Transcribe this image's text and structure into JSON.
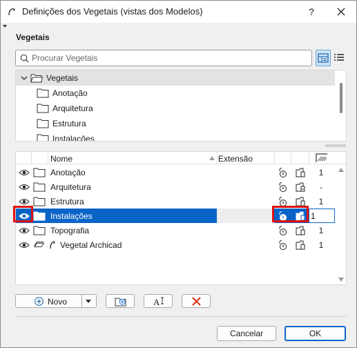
{
  "window": {
    "title": "Definições dos Vegetais (vistas dos Modelos)",
    "help_label": "?",
    "close_label": "✕"
  },
  "section": {
    "title": "Vegetais"
  },
  "search": {
    "placeholder": "Procurar Vegetais",
    "value": ""
  },
  "tree": {
    "root": {
      "label": "Vegetais",
      "expanded": true
    },
    "children": [
      {
        "label": "Anotação"
      },
      {
        "label": "Arquitetura"
      },
      {
        "label": "Estrutura"
      },
      {
        "label": "Instalações"
      }
    ]
  },
  "list": {
    "columns": {
      "name": "Nome",
      "extension": "Extensão"
    },
    "rows": [
      {
        "name": "Anotação",
        "type": "folder",
        "visible": true,
        "pen": "1",
        "selected": false
      },
      {
        "name": "Arquitetura",
        "type": "folder",
        "visible": true,
        "pen": "-",
        "selected": false
      },
      {
        "name": "Estrutura",
        "type": "folder",
        "visible": true,
        "pen": "1",
        "selected": false
      },
      {
        "name": "Instalações",
        "type": "folder",
        "visible": true,
        "pen": "1",
        "selected": true
      },
      {
        "name": "Topografia",
        "type": "folder",
        "visible": true,
        "pen": "1",
        "selected": false
      },
      {
        "name": "Vegetal Archicad",
        "type": "element",
        "visible": true,
        "pen": "1",
        "selected": false
      }
    ]
  },
  "toolbar": {
    "new_label": "Novo"
  },
  "footer": {
    "cancel_label": "Cancelar",
    "ok_label": "OK"
  },
  "colors": {
    "selection": "#0a64c8",
    "highlight": "#e01010",
    "delete_icon": "#e03010",
    "folder_add_icon": "#1a6fd0"
  }
}
